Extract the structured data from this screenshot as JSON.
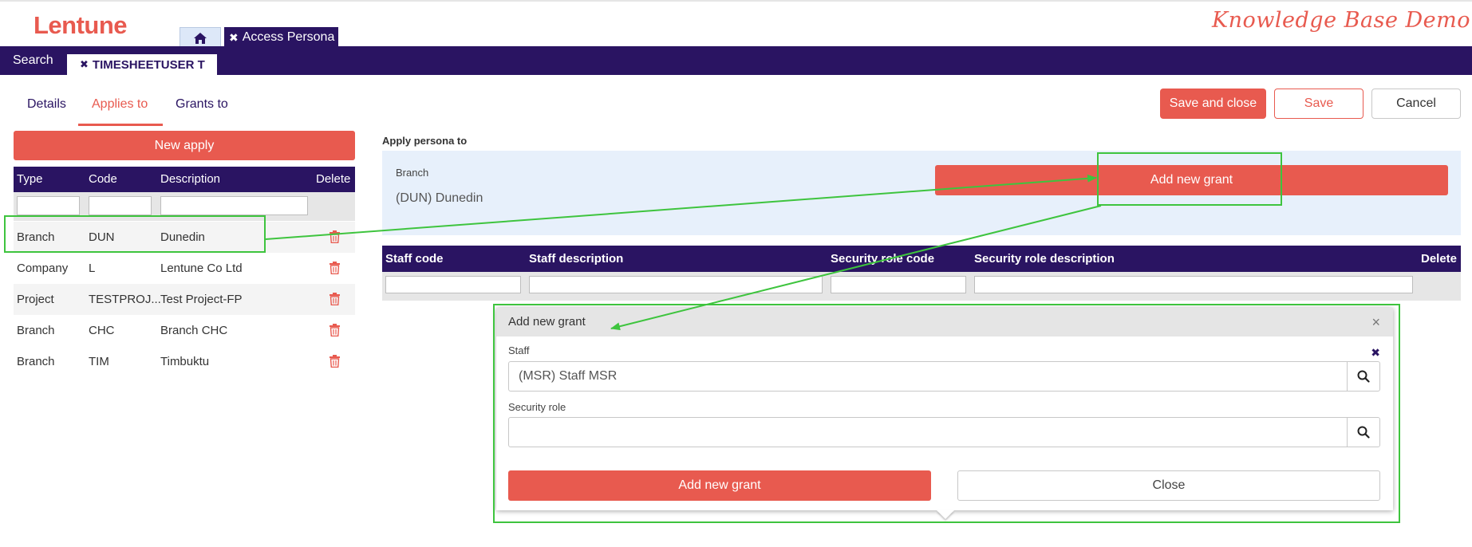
{
  "header": {
    "logo": "Lentune",
    "banner": "Knowledge Base Demo",
    "home_icon": "home-icon",
    "window_tab": "Access Persona",
    "close_icon": "close-icon"
  },
  "nav": {
    "search": "Search",
    "open_tab": "TIMESHEETUSER T"
  },
  "subtabs": [
    "Details",
    "Applies to",
    "Grants to"
  ],
  "active_subtab": "Applies to",
  "actions": {
    "save_and_close": "Save and close",
    "save": "Save",
    "cancel": "Cancel"
  },
  "left_panel": {
    "new_apply": "New apply",
    "columns": [
      "Type",
      "Code",
      "Description",
      "Delete"
    ],
    "rows": [
      {
        "type": "Branch",
        "code": "DUN",
        "description": "Dunedin"
      },
      {
        "type": "Company",
        "code": "L",
        "description": "Lentune Co Ltd"
      },
      {
        "type": "Project",
        "code": "TESTPROJ...",
        "description": "Test Project-FP"
      },
      {
        "type": "Branch",
        "code": "CHC",
        "description": "Branch CHC"
      },
      {
        "type": "Branch",
        "code": "TIM",
        "description": "Timbuktu"
      }
    ],
    "delete_icon": "trash-icon"
  },
  "apply_panel": {
    "heading": "Apply persona to",
    "field_label": "Branch",
    "field_value": "(DUN) Dunedin",
    "add_grant": "Add new grant"
  },
  "grants_table": {
    "columns": [
      "Staff code",
      "Staff description",
      "Security role code",
      "Security role description",
      "Delete"
    ]
  },
  "modal": {
    "title": "Add new grant",
    "staff_label": "Staff",
    "staff_value": "(MSR) Staff MSR",
    "role_label": "Security role",
    "role_value": "",
    "add_button": "Add new grant",
    "close_button": "Close",
    "search_icon": "search-icon"
  },
  "colors": {
    "brand": "#e85a4f",
    "navy": "#2a1462",
    "highlight": "#3ec43e",
    "apply_bg": "#e7f0fb"
  }
}
